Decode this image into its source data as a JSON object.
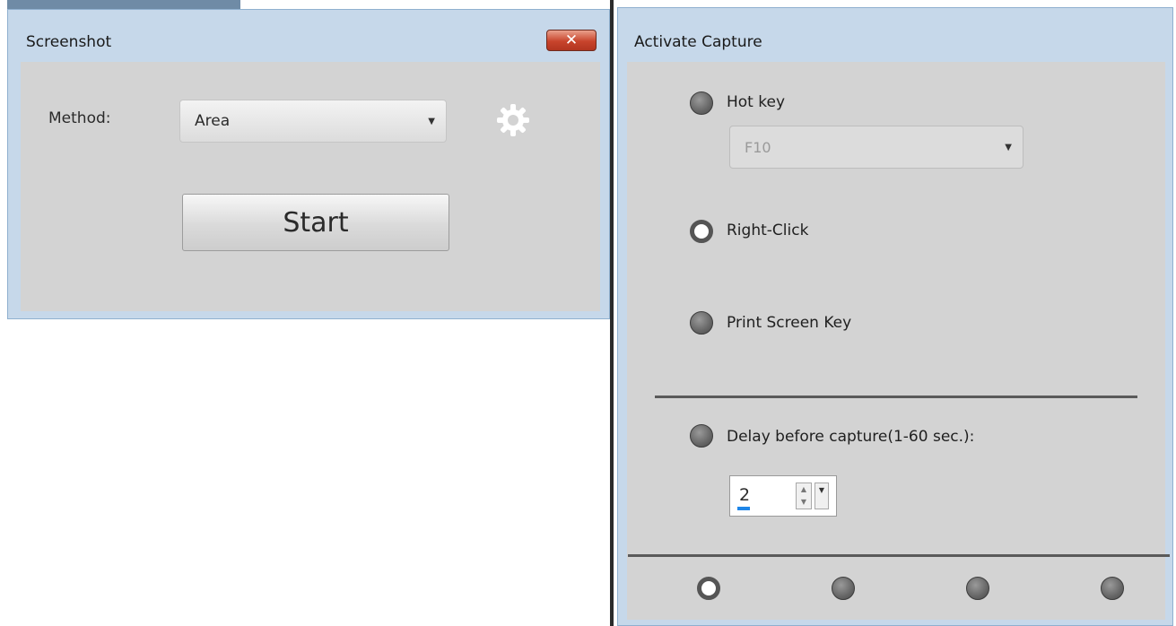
{
  "screenshot_window": {
    "title": "Screenshot",
    "close_glyph": "✕",
    "method_label": "Method:",
    "method_value": "Area",
    "start_label": "Start",
    "settings_icon": "gear-icon"
  },
  "capture_window": {
    "title": "Activate Capture",
    "hotkey_label": "Hot key",
    "hotkey_value": "F10",
    "rightclick_label": "Right-Click",
    "printscreen_label": "Print Screen Key",
    "delay_label": "Delay before capture(1-60 sec.):",
    "delay_value": "2",
    "selected_option": "Right-Click",
    "page_dots": 4,
    "active_dot": 1
  },
  "colors": {
    "window_frame": "#c6d8ea",
    "client_bg": "#d3d3d3",
    "close_red": "#c8442c",
    "progress_blue": "#1f86e8"
  }
}
